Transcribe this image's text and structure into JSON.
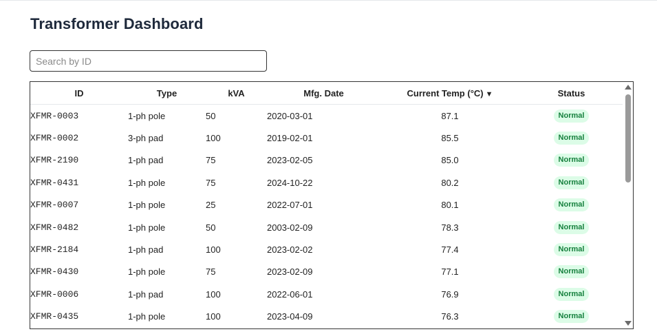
{
  "page": {
    "title": "Transformer Dashboard"
  },
  "search": {
    "placeholder": "Search by ID",
    "value": ""
  },
  "table": {
    "columns": {
      "id": "ID",
      "type": "Type",
      "kva": "kVA",
      "mfg_date": "Mfg. Date",
      "temp": "Current Temp (°C)",
      "status": "Status"
    },
    "sort_indicator": "▼",
    "rows": [
      {
        "id": "XFMR-0003",
        "type": "1-ph pole",
        "kva": "50",
        "mfg_date": "2020-03-01",
        "temp": "87.1",
        "status": "Normal"
      },
      {
        "id": "XFMR-0002",
        "type": "3-ph pad",
        "kva": "100",
        "mfg_date": "2019-02-01",
        "temp": "85.5",
        "status": "Normal"
      },
      {
        "id": "XFMR-2190",
        "type": "1-ph pad",
        "kva": "75",
        "mfg_date": "2023-02-05",
        "temp": "85.0",
        "status": "Normal"
      },
      {
        "id": "XFMR-0431",
        "type": "1-ph pole",
        "kva": "75",
        "mfg_date": "2024-10-22",
        "temp": "80.2",
        "status": "Normal"
      },
      {
        "id": "XFMR-0007",
        "type": "1-ph pole",
        "kva": "25",
        "mfg_date": "2022-07-01",
        "temp": "80.1",
        "status": "Normal"
      },
      {
        "id": "XFMR-0482",
        "type": "1-ph pole",
        "kva": "50",
        "mfg_date": "2003-02-09",
        "temp": "78.3",
        "status": "Normal"
      },
      {
        "id": "XFMR-2184",
        "type": "1-ph pad",
        "kva": "100",
        "mfg_date": "2023-02-02",
        "temp": "77.4",
        "status": "Normal"
      },
      {
        "id": "XFMR-0430",
        "type": "1-ph pole",
        "kva": "75",
        "mfg_date": "2023-02-09",
        "temp": "77.1",
        "status": "Normal"
      },
      {
        "id": "XFMR-0006",
        "type": "1-ph pad",
        "kva": "100",
        "mfg_date": "2022-06-01",
        "temp": "76.9",
        "status": "Normal"
      },
      {
        "id": "XFMR-0435",
        "type": "1-ph pole",
        "kva": "100",
        "mfg_date": "2023-04-09",
        "temp": "76.3",
        "status": "Normal"
      }
    ]
  },
  "colors": {
    "status_normal_bg": "#dcfce7",
    "status_normal_text": "#15803d"
  }
}
